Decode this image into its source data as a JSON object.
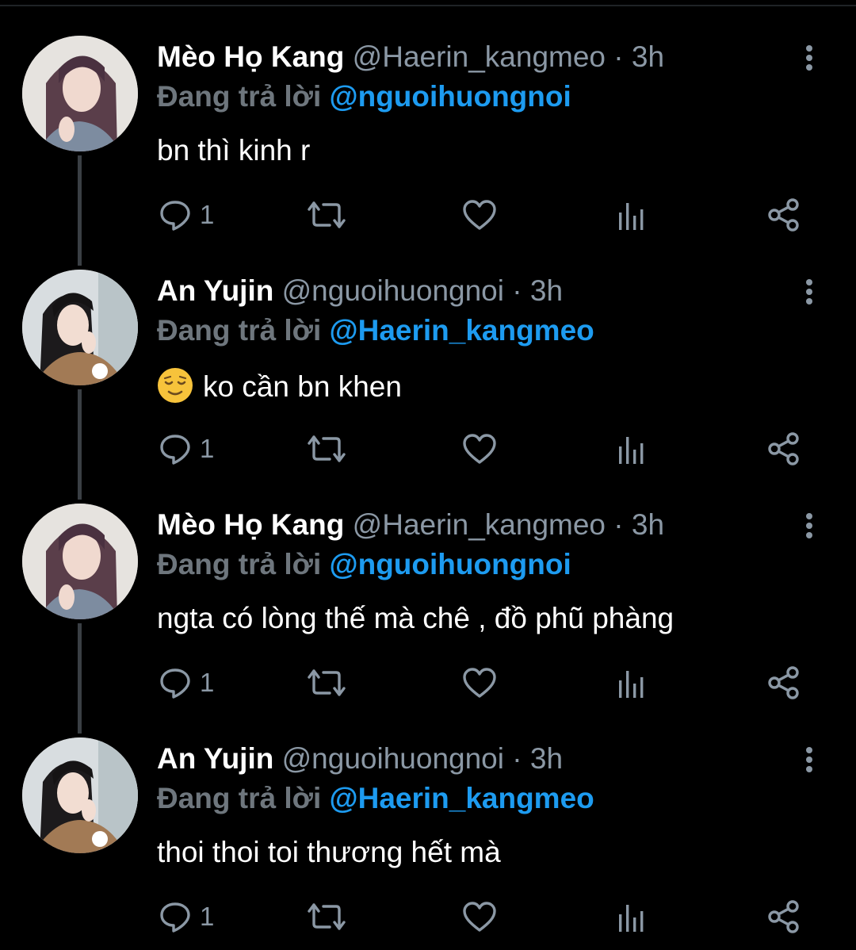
{
  "colors": {
    "background": "#000000",
    "name": "#ffffff",
    "muted": "#8b98a5",
    "mention": "#1d9bf0",
    "thread_line": "#3a3f44"
  },
  "tweets": [
    {
      "name": "Mèo Họ Kang",
      "handle": "@Haerin_kangmeo",
      "sep": "·",
      "time": "3h",
      "reply_prefix": "Đang trả lời",
      "reply_mention": "@nguoihuongnoi",
      "text": "bn thì kinh r",
      "has_emoji": false,
      "reply_count": "1",
      "avatar": "avatar-haerin"
    },
    {
      "name": "An Yujin",
      "handle": "@nguoihuongnoi",
      "sep": "·",
      "time": "3h",
      "reply_prefix": "Đang trả lời",
      "reply_mention": "@Haerin_kangmeo",
      "text": "ko cần bn khen",
      "has_emoji": true,
      "emoji": "relieved-face-emoji",
      "reply_count": "1",
      "avatar": "avatar-yujin"
    },
    {
      "name": "Mèo Họ Kang",
      "handle": "@Haerin_kangmeo",
      "sep": "·",
      "time": "3h",
      "reply_prefix": "Đang trả lời",
      "reply_mention": "@nguoihuongnoi",
      "text": "ngta có lòng thế mà chê , đồ phũ phàng",
      "has_emoji": false,
      "reply_count": "1",
      "avatar": "avatar-haerin"
    },
    {
      "name": "An Yujin",
      "handle": "@nguoihuongnoi",
      "sep": "·",
      "time": "3h",
      "reply_prefix": "Đang trả lời",
      "reply_mention": "@Haerin_kangmeo",
      "text": "thoi thoi toi thương hết mà",
      "has_emoji": false,
      "reply_count": "1",
      "avatar": "avatar-yujin"
    }
  ],
  "icons": {
    "reply": "reply-icon",
    "retweet": "retweet-icon",
    "like": "heart-icon",
    "views": "bar-chart-icon",
    "share": "share-icon",
    "more": "more-vertical-icon"
  }
}
